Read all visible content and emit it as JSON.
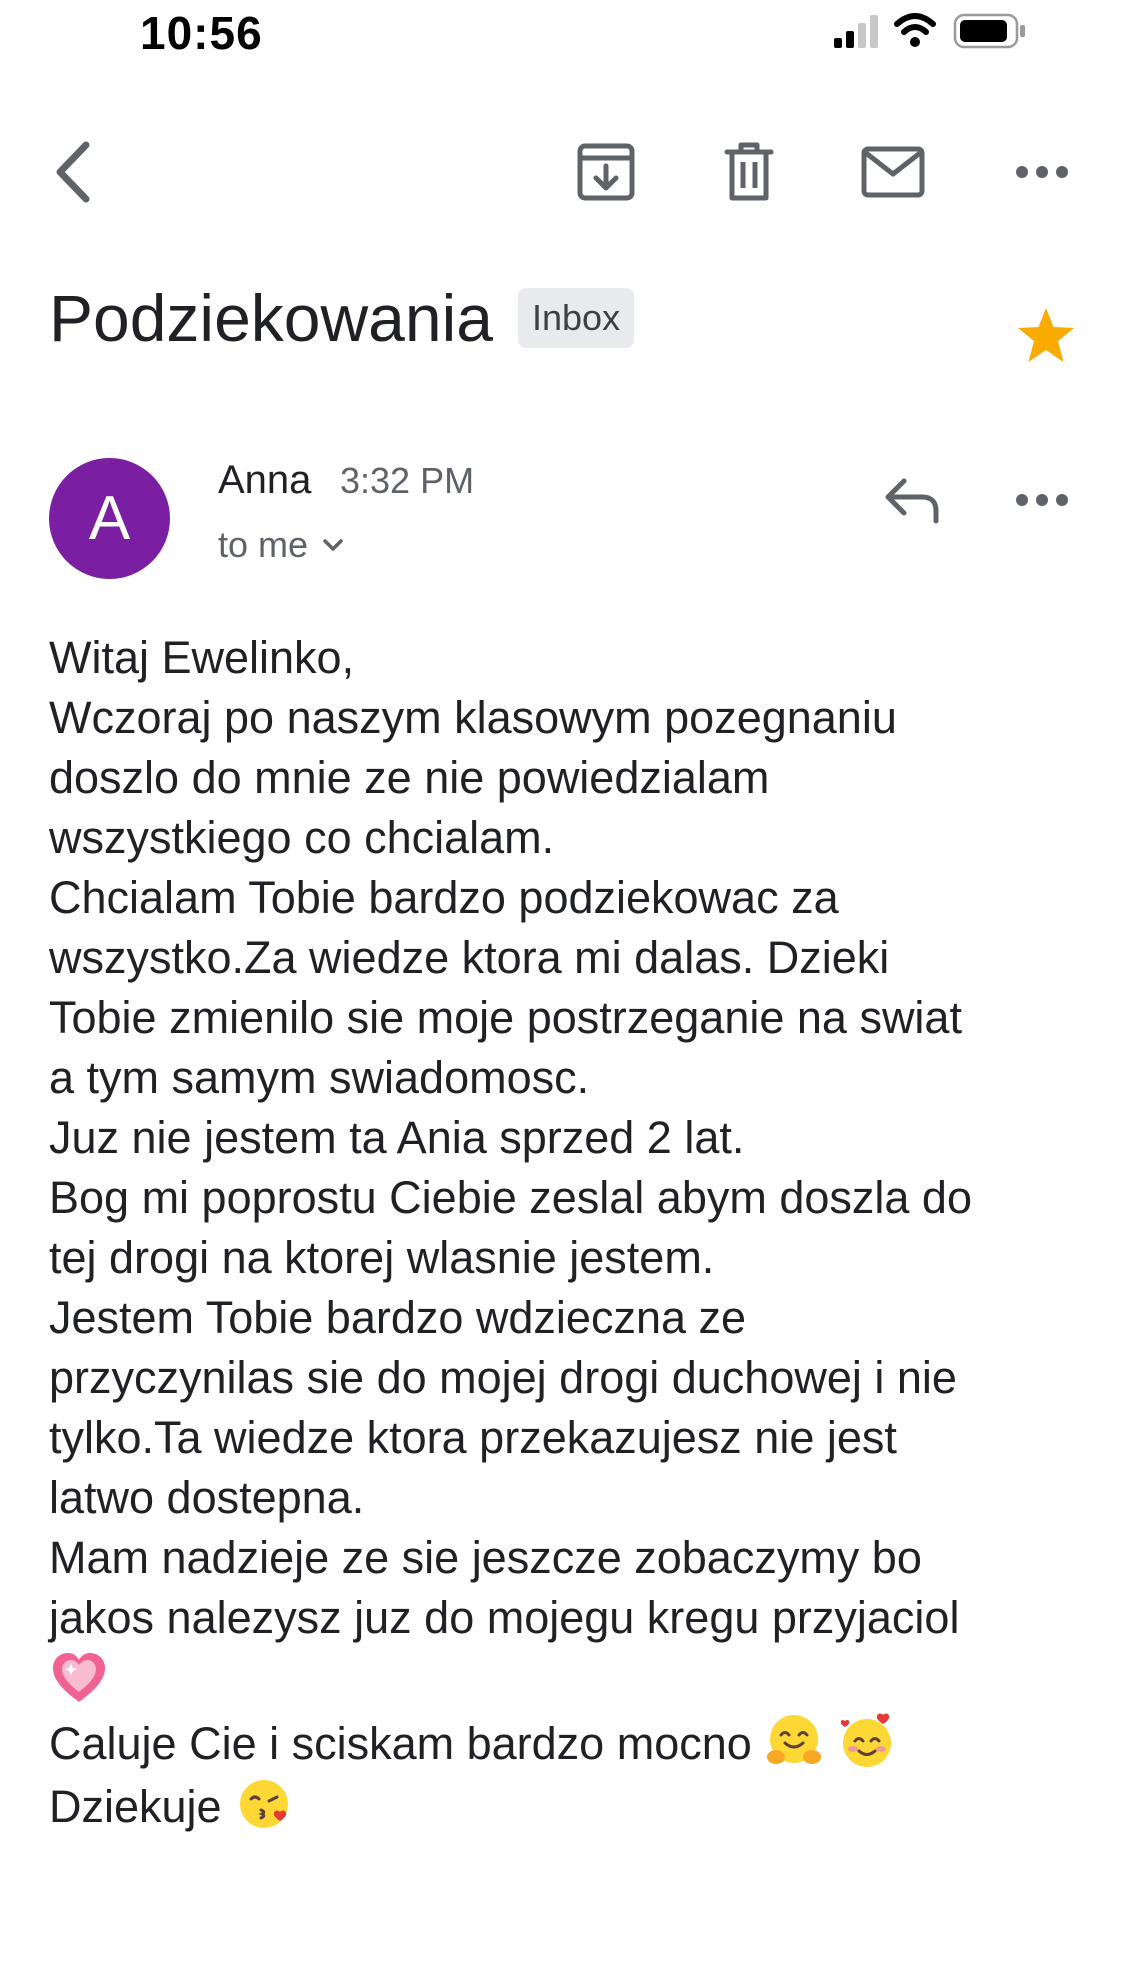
{
  "status_bar": {
    "time": "10:56",
    "icons": [
      "cellular-signal-icon",
      "wifi-icon",
      "battery-icon"
    ]
  },
  "toolbar": {
    "icons": [
      "back-arrow-icon",
      "archive-icon",
      "trash-icon",
      "mark-unread-mail-icon",
      "more-options-icon"
    ]
  },
  "email": {
    "subject": "Podziekowania",
    "label": "Inbox",
    "starred": true,
    "star_color": "#f9ab00",
    "sender": {
      "initial": "A",
      "name": "Anna",
      "time": "3:32 PM",
      "recipient": "to me",
      "avatar_color": "#7b1fa2"
    },
    "body_lines": [
      "Witaj Ewelinko,",
      "Wczoraj po naszym klasowym pozegnaniu",
      "doszlo do mnie ze nie powiedzialam",
      "wszystkiego co chcialam.",
      "Chcialam Tobie bardzo podziekowac za",
      "wszystko.Za wiedze ktora mi dalas. Dzieki",
      "Tobie zmienilo sie moje postrzeganie na swiat",
      "a tym samym swiadomosc.",
      "Juz nie jestem ta Ania sprzed 2 lat.",
      "Bog mi poprostu Ciebie zeslal abym doszla do",
      "tej drogi na ktorej wlasnie jestem.",
      "Jestem Tobie bardzo wdzieczna ze",
      "przyczynilas sie do mojej drogi duchowej i nie",
      "tylko.Ta wiedze ktora przekazujesz nie jest",
      "latwo dostepna.",
      "Mam nadzieje ze sie jeszcze zobaczymy bo",
      "jakos nalezysz juz do mojegu kregu przyjaciol"
    ],
    "closing_line_1": "Caluje Cie i sciskam bardzo mocno",
    "closing_line_2": "Dziekuje",
    "emojis": [
      "sparkling-heart-emoji",
      "hugging-face-emoji",
      "smiling-face-with-hearts-emoji",
      "face-blowing-kiss-emoji"
    ]
  }
}
